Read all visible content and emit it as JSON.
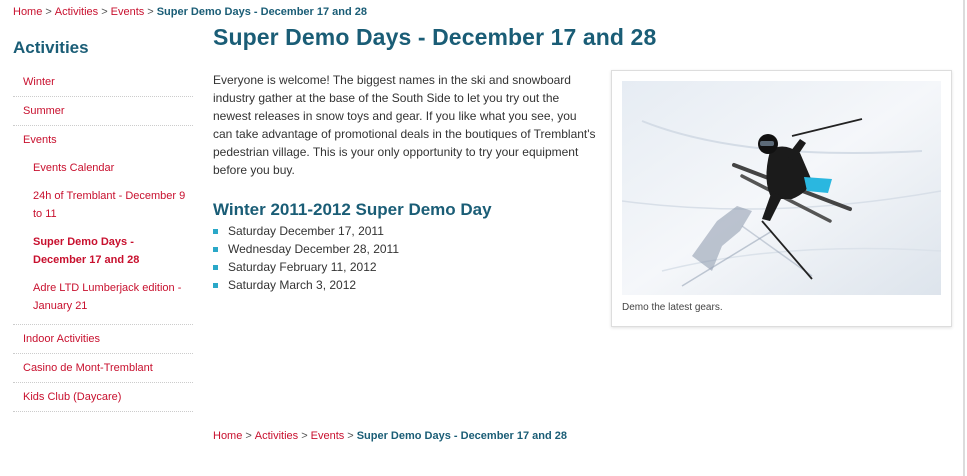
{
  "breadcrumb": {
    "home": "Home",
    "activities": "Activities",
    "events": "Events",
    "current": "Super Demo Days - December 17 and 28",
    "separator": ">"
  },
  "sidebar": {
    "title": "Activities",
    "items": [
      {
        "label": "Winter"
      },
      {
        "label": "Summer"
      },
      {
        "label": "Events"
      },
      {
        "label": "Indoor Activities"
      },
      {
        "label": "Casino de Mont-Tremblant"
      },
      {
        "label": "Kids Club (Daycare)"
      }
    ],
    "events_children": [
      {
        "label": "Events Calendar"
      },
      {
        "label": "24h of Tremblant - December 9 to 11"
      },
      {
        "label": "Super Demo Days - December 17 and 28"
      },
      {
        "label": "Adre LTD Lumberjack edition - January 21"
      }
    ]
  },
  "main": {
    "title": "Super Demo Days - December 17 and 28",
    "intro": "Everyone is welcome! The biggest names in the ski and snowboard industry gather at the base of the South Side to let you try out the newest releases in snow toys and gear. If you like what you see, you can take advantage of promotional deals in the boutiques of Tremblant's pedestrian village. This is your only opportunity to try your equipment before you buy.",
    "subheading": "Winter 2011-2012 Super Demo Day",
    "dates": [
      "Saturday December 17, 2011",
      "Wednesday December 28, 2011",
      "Saturday February 11, 2012",
      "Saturday March 3, 2012"
    ],
    "photo_caption": "Demo the latest gears."
  },
  "colors": {
    "link": "#c8102e",
    "heading": "#1a5d76",
    "bullet": "#2aa8c8"
  }
}
